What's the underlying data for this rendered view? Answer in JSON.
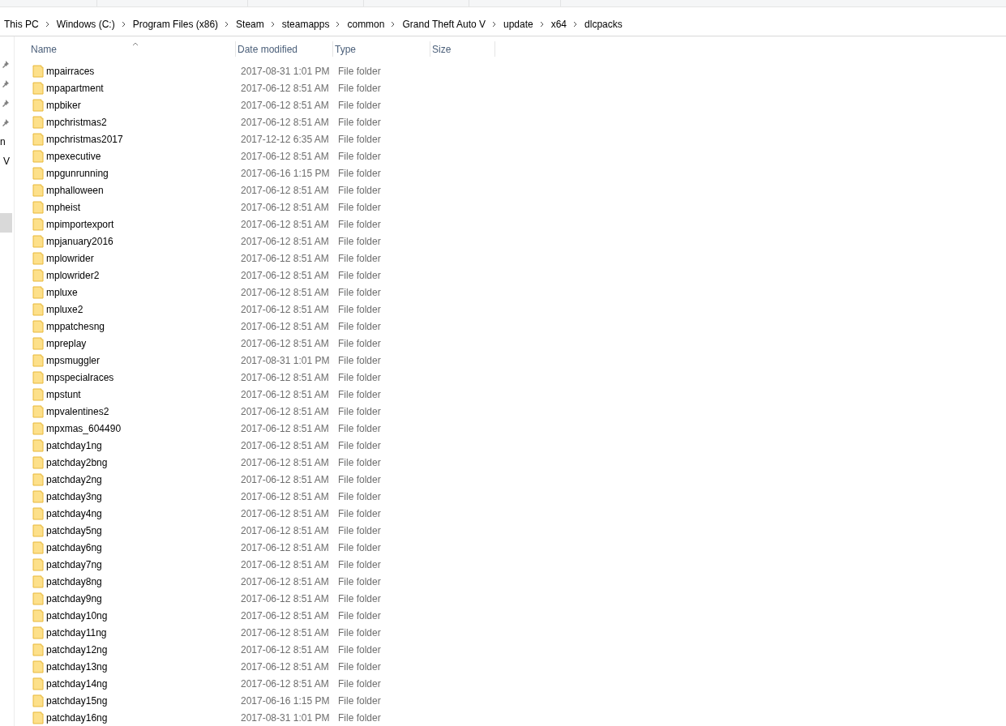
{
  "breadcrumb": [
    "This PC",
    "Windows (C:)",
    "Program Files (x86)",
    "Steam",
    "steamapps",
    "common",
    "Grand Theft Auto V",
    "update",
    "x64",
    "dlcpacks"
  ],
  "nav_pane": {
    "items": [
      {
        "kind": "pin"
      },
      {
        "kind": "pin"
      },
      {
        "kind": "pin"
      },
      {
        "kind": "pin"
      },
      {
        "kind": "text",
        "label": "n"
      },
      {
        "kind": "text",
        "label": "V"
      },
      {
        "kind": "blank",
        "selected": true
      }
    ]
  },
  "columns": [
    {
      "label": "Name",
      "sorted": true
    },
    {
      "label": "Date modified",
      "sorted": false
    },
    {
      "label": "Type",
      "sorted": false
    },
    {
      "label": "Size",
      "sorted": false
    }
  ],
  "rows": [
    {
      "name": "mpairraces",
      "date": "2017-08-31 1:01 PM",
      "type": "File folder"
    },
    {
      "name": "mpapartment",
      "date": "2017-06-12 8:51 AM",
      "type": "File folder"
    },
    {
      "name": "mpbiker",
      "date": "2017-06-12 8:51 AM",
      "type": "File folder"
    },
    {
      "name": "mpchristmas2",
      "date": "2017-06-12 8:51 AM",
      "type": "File folder"
    },
    {
      "name": "mpchristmas2017",
      "date": "2017-12-12 6:35 AM",
      "type": "File folder"
    },
    {
      "name": "mpexecutive",
      "date": "2017-06-12 8:51 AM",
      "type": "File folder"
    },
    {
      "name": "mpgunrunning",
      "date": "2017-06-16 1:15 PM",
      "type": "File folder"
    },
    {
      "name": "mphalloween",
      "date": "2017-06-12 8:51 AM",
      "type": "File folder"
    },
    {
      "name": "mpheist",
      "date": "2017-06-12 8:51 AM",
      "type": "File folder"
    },
    {
      "name": "mpimportexport",
      "date": "2017-06-12 8:51 AM",
      "type": "File folder"
    },
    {
      "name": "mpjanuary2016",
      "date": "2017-06-12 8:51 AM",
      "type": "File folder"
    },
    {
      "name": "mplowrider",
      "date": "2017-06-12 8:51 AM",
      "type": "File folder"
    },
    {
      "name": "mplowrider2",
      "date": "2017-06-12 8:51 AM",
      "type": "File folder"
    },
    {
      "name": "mpluxe",
      "date": "2017-06-12 8:51 AM",
      "type": "File folder"
    },
    {
      "name": "mpluxe2",
      "date": "2017-06-12 8:51 AM",
      "type": "File folder"
    },
    {
      "name": "mppatchesng",
      "date": "2017-06-12 8:51 AM",
      "type": "File folder"
    },
    {
      "name": "mpreplay",
      "date": "2017-06-12 8:51 AM",
      "type": "File folder"
    },
    {
      "name": "mpsmuggler",
      "date": "2017-08-31 1:01 PM",
      "type": "File folder"
    },
    {
      "name": "mpspecialraces",
      "date": "2017-06-12 8:51 AM",
      "type": "File folder"
    },
    {
      "name": "mpstunt",
      "date": "2017-06-12 8:51 AM",
      "type": "File folder"
    },
    {
      "name": "mpvalentines2",
      "date": "2017-06-12 8:51 AM",
      "type": "File folder"
    },
    {
      "name": "mpxmas_604490",
      "date": "2017-06-12 8:51 AM",
      "type": "File folder"
    },
    {
      "name": "patchday1ng",
      "date": "2017-06-12 8:51 AM",
      "type": "File folder"
    },
    {
      "name": "patchday2bng",
      "date": "2017-06-12 8:51 AM",
      "type": "File folder"
    },
    {
      "name": "patchday2ng",
      "date": "2017-06-12 8:51 AM",
      "type": "File folder"
    },
    {
      "name": "patchday3ng",
      "date": "2017-06-12 8:51 AM",
      "type": "File folder"
    },
    {
      "name": "patchday4ng",
      "date": "2017-06-12 8:51 AM",
      "type": "File folder"
    },
    {
      "name": "patchday5ng",
      "date": "2017-06-12 8:51 AM",
      "type": "File folder"
    },
    {
      "name": "patchday6ng",
      "date": "2017-06-12 8:51 AM",
      "type": "File folder"
    },
    {
      "name": "patchday7ng",
      "date": "2017-06-12 8:51 AM",
      "type": "File folder"
    },
    {
      "name": "patchday8ng",
      "date": "2017-06-12 8:51 AM",
      "type": "File folder"
    },
    {
      "name": "patchday9ng",
      "date": "2017-06-12 8:51 AM",
      "type": "File folder"
    },
    {
      "name": "patchday10ng",
      "date": "2017-06-12 8:51 AM",
      "type": "File folder"
    },
    {
      "name": "patchday11ng",
      "date": "2017-06-12 8:51 AM",
      "type": "File folder"
    },
    {
      "name": "patchday12ng",
      "date": "2017-06-12 8:51 AM",
      "type": "File folder"
    },
    {
      "name": "patchday13ng",
      "date": "2017-06-12 8:51 AM",
      "type": "File folder"
    },
    {
      "name": "patchday14ng",
      "date": "2017-06-12 8:51 AM",
      "type": "File folder"
    },
    {
      "name": "patchday15ng",
      "date": "2017-06-16 1:15 PM",
      "type": "File folder"
    },
    {
      "name": "patchday16ng",
      "date": "2017-08-31 1:01 PM",
      "type": "File folder"
    }
  ]
}
